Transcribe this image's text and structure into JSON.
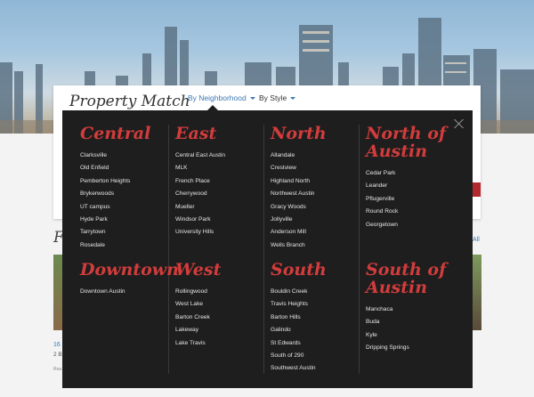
{
  "card": {
    "title": "Property Match",
    "tabs": [
      {
        "label": "By Neighborhood",
        "active": true
      },
      {
        "label": "By Style",
        "active": false
      }
    ]
  },
  "background": {
    "heading_fragment": "F",
    "all_link_fragment": "All",
    "price_fragment": "16",
    "beds_fragment": "2 B",
    "small_fragment": "Rea"
  },
  "colors": {
    "panel_bg": "#1e1e1e",
    "region_title": "#d23c3c",
    "link_text": "#e6e6e6",
    "active_tab": "#3a78b5"
  },
  "dropdown": {
    "close_icon": "close-icon",
    "regions": [
      {
        "title": "Central",
        "neighborhoods": [
          "Clarksville",
          "Old Enfield",
          "Pemberton Heights",
          "Brykerwoods",
          "UT campus",
          "Hyde Park",
          "Tarrytown",
          "Rosedale"
        ]
      },
      {
        "title": "East",
        "neighborhoods": [
          "Central East Austin",
          "MLK",
          "French Place",
          "Cherrywood",
          "Mueller",
          "Windsor Park",
          "University Hills"
        ]
      },
      {
        "title": "North",
        "neighborhoods": [
          "Allandale",
          "Crestview",
          "Highland North",
          "Northwest Austin",
          "Gracy Woods",
          "Jollyville",
          "Anderson Mill",
          "Wells Branch"
        ]
      },
      {
        "title": "North of Austin",
        "neighborhoods": [
          "Cedar Park",
          "Leander",
          "Pflugerville",
          "Round Rock",
          "Georgetown"
        ]
      },
      {
        "title": "Downtown",
        "neighborhoods": [
          "Downtown Austin"
        ]
      },
      {
        "title": "West",
        "neighborhoods": [
          "Rollingwood",
          "West Lake",
          "Barton Creek",
          "Lakeway",
          "Lake Travis"
        ]
      },
      {
        "title": "South",
        "neighborhoods": [
          "Bouldin Creek",
          "Travis Heights",
          "Barton Hills",
          "Galindo",
          "St Edwards",
          "South of 290",
          "Southwest Austin"
        ]
      },
      {
        "title": "South of Austin",
        "neighborhoods": [
          "Manchaca",
          "Buda",
          "Kyle",
          "Dripping Springs"
        ]
      }
    ]
  }
}
